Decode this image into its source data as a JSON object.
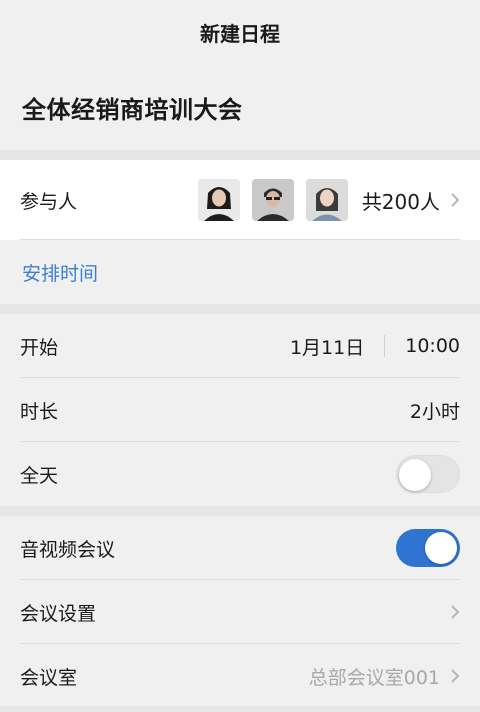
{
  "nav": {
    "title": "新建日程"
  },
  "event": {
    "title": "全体经销商培训大会"
  },
  "participants": {
    "label": "参与人",
    "count_text": "共200人",
    "avatars": [
      "avatar-1",
      "avatar-2",
      "avatar-3"
    ]
  },
  "schedule_link": "安排时间",
  "start": {
    "label": "开始",
    "date": "1月11日",
    "time": "10:00"
  },
  "duration": {
    "label": "时长",
    "value": "2小时"
  },
  "all_day": {
    "label": "全天",
    "enabled": false
  },
  "video_meeting": {
    "label": "音视频会议",
    "enabled": true
  },
  "meeting_settings": {
    "label": "会议设置"
  },
  "meeting_room": {
    "label": "会议室",
    "value": "总部会议室001"
  },
  "colors": {
    "accent": "#2f74d0",
    "link": "#3b7fd6",
    "muted": "#a8a8a8"
  },
  "icons": {
    "chevron": "chevron-right-icon"
  }
}
